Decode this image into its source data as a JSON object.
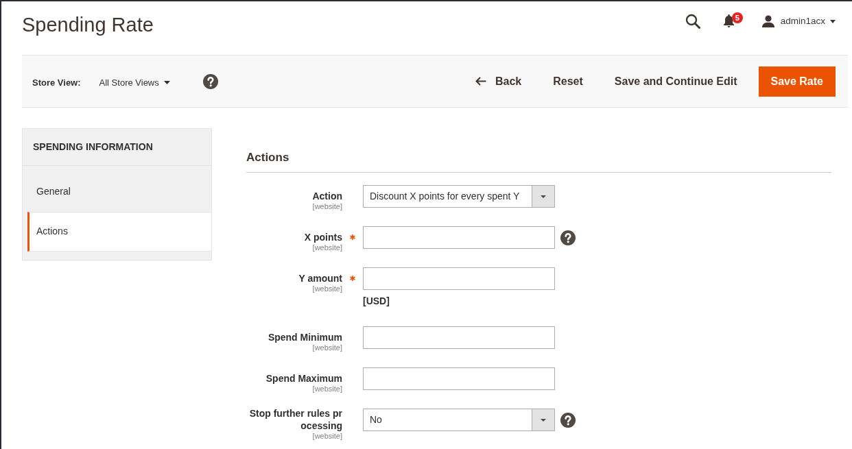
{
  "page_title": "Spending Rate",
  "header": {
    "notification_count": "5",
    "user_name": "admin1acx"
  },
  "toolbar": {
    "store_view_label": "Store View:",
    "store_view": "All Store Views",
    "buttons": [
      {
        "label": "Back",
        "kind": "back"
      },
      {
        "label": "Reset",
        "kind": "secondary"
      },
      {
        "label": "Save and Continue Edit",
        "kind": "secondary"
      },
      {
        "label": "Save Rate",
        "kind": "primary"
      }
    ]
  },
  "sidebar": {
    "title": "SPENDING INFORMATION",
    "items": [
      {
        "label": "General",
        "selected": false
      },
      {
        "label": "Actions",
        "selected": true
      }
    ]
  },
  "section": {
    "title": "Actions",
    "fields": [
      {
        "kind": "select",
        "label": "Action",
        "scope": "[website]",
        "required": false,
        "help": false,
        "value": "Discount X points for every spent Y"
      },
      {
        "kind": "input",
        "label": "X points",
        "scope": "[website]",
        "required": true,
        "help": true
      },
      {
        "kind": "input",
        "label": "Y amount",
        "scope": "[website]",
        "required": true,
        "help": false,
        "note": "[USD]"
      },
      {
        "kind": "input",
        "label": "Spend Minimum",
        "scope": "[website]",
        "required": false,
        "help": false
      },
      {
        "kind": "input",
        "label": "Spend Maximum",
        "scope": "[website]",
        "required": false,
        "help": false
      },
      {
        "kind": "select",
        "label": "Stop further rules processing",
        "scope": "[website]",
        "required": false,
        "help": true,
        "value": "No"
      }
    ]
  }
}
